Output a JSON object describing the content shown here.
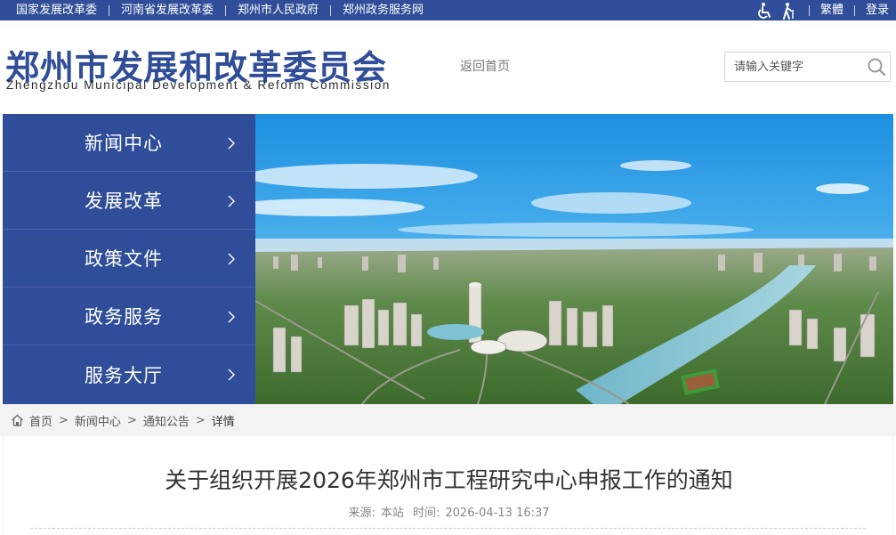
{
  "topbar": {
    "links": [
      "国家发展改革委",
      "河南省发展改革委",
      "郑州市人民政府",
      "郑州政务服务网"
    ],
    "traditional": "繁體",
    "login": "登录",
    "icons": [
      "wheelchair-icon",
      "elderly-icon"
    ]
  },
  "header": {
    "title_cn": "郑州市发展和改革委员会",
    "title_en": "Zhengzhou Municipal Development & Reform Commission",
    "back_home": "返回首页",
    "search_placeholder": "请输入关键字",
    "brand_color": "#2f4d98"
  },
  "nav": {
    "items": [
      {
        "label": "新闻中心"
      },
      {
        "label": "发展改革"
      },
      {
        "label": "政策文件"
      },
      {
        "label": "政务服务"
      },
      {
        "label": "服务大厅"
      }
    ]
  },
  "breadcrumb": {
    "items": [
      "首页",
      "新闻中心",
      "通知公告",
      "详情"
    ]
  },
  "article": {
    "title": "关于组织开展2026年郑州市工程研究中心申报工作的通知",
    "source_label": "来源:",
    "source": "本站",
    "time_label": "时间:",
    "time": "2026-04-13 16:37"
  }
}
